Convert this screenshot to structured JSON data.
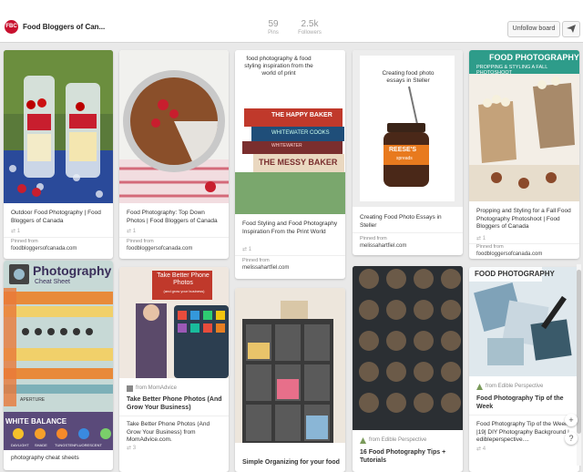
{
  "header": {
    "avatar_text": "FBC",
    "board_title": "Food Bloggers of Can...",
    "pins_count": "59",
    "pins_label": "Pins",
    "followers_count": "2.5k",
    "followers_label": "Followers",
    "unfollow_label": "Unfollow board"
  },
  "pins": [
    {
      "desc": "Outdoor Food Photography | Food Bloggers of Canada",
      "repins": "1",
      "pinned_from_label": "Pinned from",
      "source": "foodbloggersofcanada.com"
    },
    {
      "desc": "Food Photography: Top Down Photos | Food Bloggers of Canada",
      "repins": "1",
      "pinned_from_label": "Pinned from",
      "source": "foodbloggersofcanada.com"
    },
    {
      "image_text": "food photography & food styling inspiration from the world of print",
      "book1": "THE HAPPY BAKER",
      "book2": "WHITEWATER COOKS",
      "book3": "THE MESSY BAKER",
      "book4": "WHITEWATER",
      "desc": "Food Styling and Food Photography Inspiration From the Print World",
      "repins": "1",
      "pinned_from_label": "Pinned from",
      "source": "melissahartfiel.com"
    },
    {
      "image_text": "Creating food photo essays in Steller",
      "jar_brand": "REESE'S",
      "jar_sub": "spreads",
      "desc": "Creating Food Photo Essays in Steller",
      "pinned_from_label": "Pinned from",
      "source": "melissahartfiel.com"
    },
    {
      "image_title": "FOOD PHOTOGRAPHY",
      "image_sub": "PROPPING & STYLING A FALL PHOTOSHOOT",
      "desc": "Propping and Styling for a Fall Food Photography Photoshoot | Food Bloggers of Canada",
      "repins": "1",
      "pinned_from_label": "Pinned from",
      "source": "foodbloggersofcanada.com"
    },
    {
      "image_title": "Photography",
      "image_sub": "Cheat Sheet",
      "left_label": "SHUTTER SPEED",
      "mid_label": "APERTURE",
      "white_balance": "WHITE BALANCE",
      "wb_items": [
        "DAYLIGHT",
        "SHADE",
        "TUNGSTEN",
        "FLUORESCENT"
      ],
      "desc": "photography cheat sheets"
    },
    {
      "image_title": "Take Better Phone Photos",
      "image_sub": "(and grow your business)",
      "via": "from MomAdvice",
      "title": "Take Better Phone Photos (And Grow Your Business)",
      "desc": "Take Better Phone Photos (And Grow Your Business) from MomAdvice.com.",
      "repins": "3"
    },
    {
      "title": "Simple Organizing for your food"
    },
    {
      "via": "from Edible Perspective",
      "title": "16 Food Photography Tips + Tutorials"
    },
    {
      "image_title": "FOOD PHOTOGRAPHY",
      "via": "from Edible Perspective",
      "title": "Food Photography Tip of the Week",
      "desc": "Food Photography Tip of the Week |19| DIY Photography Background | edibleperspective....",
      "repins": "4"
    }
  ],
  "floating": {
    "plus": "+",
    "help": "?"
  },
  "colors": {
    "brand_red": "#c8102e",
    "background": "#e9e9e9"
  }
}
